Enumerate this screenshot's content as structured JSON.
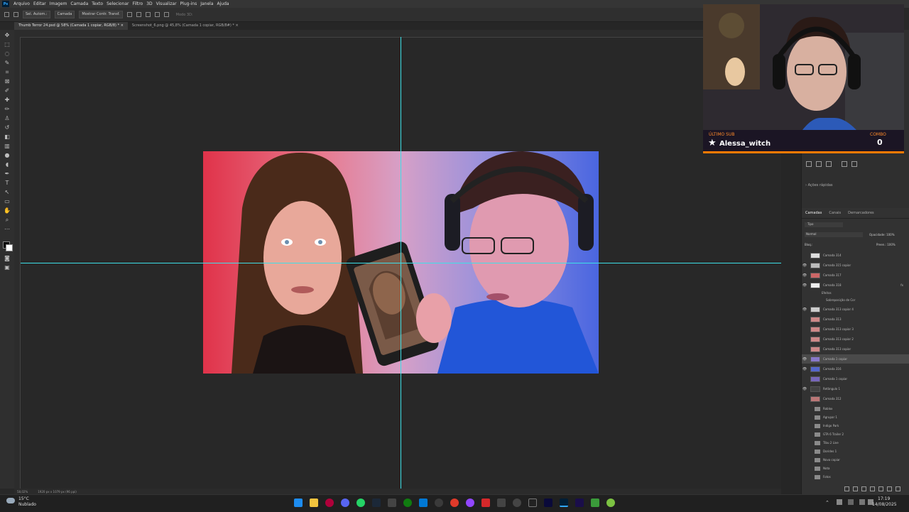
{
  "menubar": {
    "items": [
      "Arquivo",
      "Editar",
      "Imagem",
      "Camada",
      "Texto",
      "Selecionar",
      "Filtro",
      "3D",
      "Visualizar",
      "Plug-ins",
      "Janela",
      "Ajuda"
    ]
  },
  "options": {
    "auto_select": "Sel. Autom.:",
    "auto_select_value": "Camada",
    "transform": "Mostrar Contr. Transf.",
    "mode_3d": "Modo 3D:"
  },
  "tabs": [
    {
      "label": "Thumb Terror 24.psd @ 58% (Camada 1 copiar, RGB/8) *",
      "close": "×"
    },
    {
      "label": "Screenshot_6.png @ 45,8% (Camada 1 copiar, RGB/8#) *",
      "close": "×"
    }
  ],
  "status": {
    "zoom": "58,02%",
    "doc": "1920 px x 1079 px (96 ppi)"
  },
  "webcam": {
    "sub_label": "ÚLTIMO SUB",
    "sub_name": "Alessa_witch",
    "combo_label": "COMBO",
    "combo_value": "0"
  },
  "panels": {
    "quick_actions": "Ações rápidas",
    "tabs": [
      "Camadas",
      "Canais",
      "Demarcadores"
    ],
    "filter": "Tipo",
    "blend": "Normal",
    "opacity_label": "Opacidade:",
    "opacity": "100%",
    "lock_label": "Bloq.:",
    "fill_label": "Preen.:",
    "fill": "100%",
    "layers": [
      {
        "name": "Camada 314",
        "visible": false
      },
      {
        "name": "Camada 315 copiar",
        "visible": true
      },
      {
        "name": "Camada 317",
        "visible": true
      },
      {
        "name": "Camada 318",
        "visible": true
      },
      {
        "name": "Efeitos",
        "visible": false
      },
      {
        "name": "Sobreposição de Cor",
        "visible": false
      },
      {
        "name": "Camada 313 copiar 4",
        "visible": true
      },
      {
        "name": "Camada 313",
        "visible": false
      },
      {
        "name": "Camada 313 copiar 3",
        "visible": false
      },
      {
        "name": "Camada 313 copiar 2",
        "visible": false
      },
      {
        "name": "Camada 313 copiar",
        "visible": false
      },
      {
        "name": "Camada 1 copiar",
        "visible": true,
        "selected": true
      },
      {
        "name": "Camada 316",
        "visible": true
      },
      {
        "name": "Camada 1 copiar",
        "visible": false
      },
      {
        "name": "Retângulo 1",
        "visible": true
      },
      {
        "name": "Camada 312",
        "visible": false
      }
    ],
    "groups": [
      "Roblox",
      "Agrupar 1",
      "Indigo Park",
      "GTA 6 Trailer 2",
      "Tibu 2 Live",
      "Dorides 1",
      "Nova copiar",
      "Nota",
      "Fotos"
    ]
  },
  "taskbar": {
    "temp": "15°C",
    "weather": "Nublado",
    "time": "17:19",
    "date": "14/08/2025"
  }
}
